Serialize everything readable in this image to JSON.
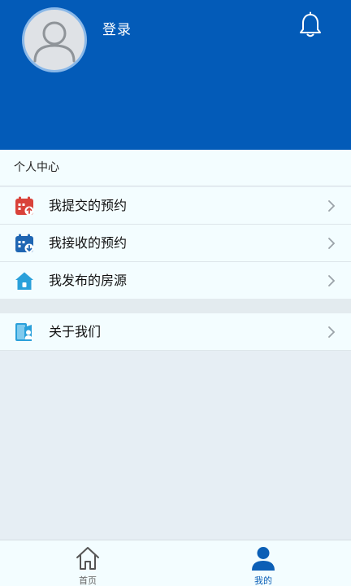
{
  "header": {
    "login_label": "登录"
  },
  "section": {
    "title": "个人中心"
  },
  "menu": [
    {
      "label": "我提交的预约",
      "icon": "calendar-upload-icon",
      "color": "#d9423a"
    },
    {
      "label": "我接收的预约",
      "icon": "calendar-download-icon",
      "color": "#1f66b3"
    },
    {
      "label": "我发布的房源",
      "icon": "house-icon",
      "color": "#2aa0da"
    },
    {
      "label": "关于我们",
      "icon": "user-book-icon",
      "color": "#2aa0da"
    }
  ],
  "tabs": [
    {
      "label": "首页",
      "icon": "home-icon",
      "active": false
    },
    {
      "label": "我的",
      "icon": "user-icon",
      "active": true
    }
  ],
  "colors": {
    "header_bg": "#035bb8",
    "accent": "#0b5fb6"
  }
}
